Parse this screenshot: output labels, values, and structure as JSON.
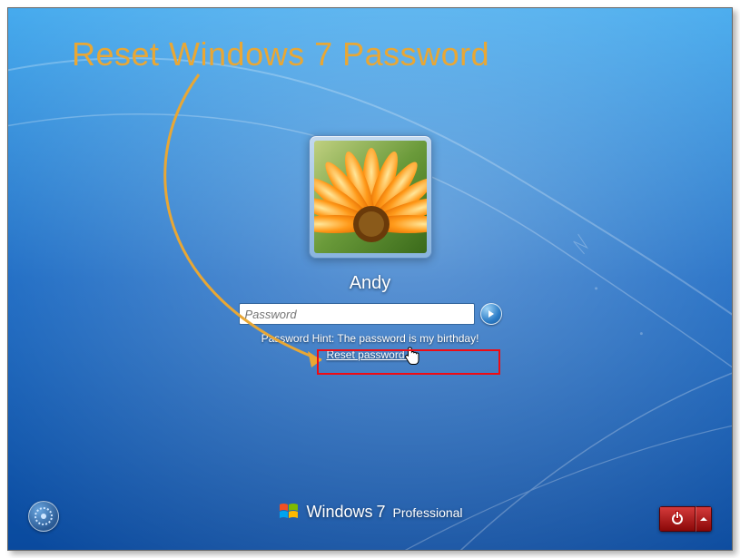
{
  "annotation": {
    "title": "Reset Windows 7 Password"
  },
  "user": {
    "name": "Andy"
  },
  "password": {
    "placeholder": "Password",
    "hint": "Password Hint: The password is my birthday!",
    "reset_link": "Reset password..."
  },
  "branding": {
    "windows": "Windows",
    "version": "7",
    "edition": "Professional"
  },
  "icons": {
    "go_arrow": "arrow-right-icon",
    "ease": "ease-of-access-icon",
    "power": "power-icon",
    "chevron": "chevron-up-icon",
    "logo": "windows-logo-icon",
    "cursor": "hand-cursor-icon"
  },
  "colors": {
    "annotation": "#e8a735",
    "highlight_box": "#ef0b13",
    "shutdown": "#b01414"
  }
}
